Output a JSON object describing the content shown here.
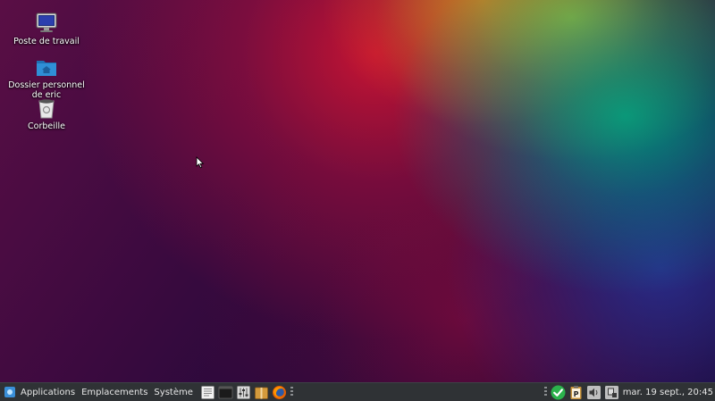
{
  "desktop": {
    "icons": [
      {
        "label": "Poste de travail",
        "icon": "computer-icon"
      },
      {
        "label": "Dossier personnel de eric",
        "icon": "home-folder-icon"
      },
      {
        "label": "Corbeille",
        "icon": "trash-icon"
      }
    ]
  },
  "taskbar": {
    "menus": {
      "applications": "Applications",
      "places": "Emplacements",
      "system": "Système"
    },
    "launchers": [
      "text-editor-icon",
      "terminal-icon",
      "settings-mixer-icon",
      "archive-box-icon",
      "firefox-icon"
    ],
    "tray": [
      "update-ok-icon",
      "clipboard-icon",
      "volume-icon",
      "network-icon"
    ],
    "clock": "mar. 19 sept., 20:45"
  },
  "colors": {
    "taskbar_bg": "#2f3235",
    "update_ok": "#2bb24c",
    "folder_blue": "#2f8fd6"
  }
}
